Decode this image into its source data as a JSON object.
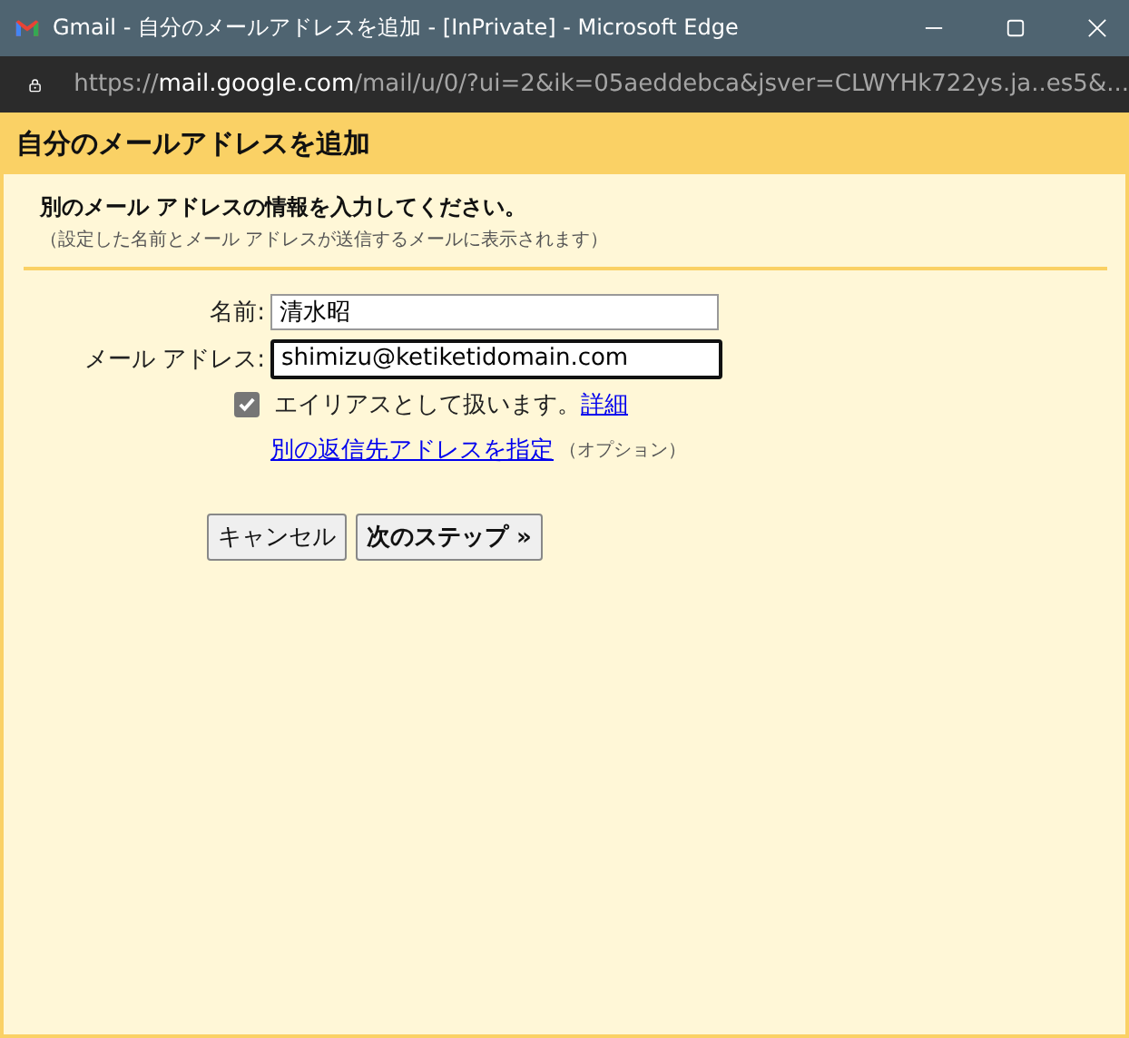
{
  "window": {
    "title": "Gmail - 自分のメールアドレスを追加 - [InPrivate] - Microsoft Edge"
  },
  "address_bar": {
    "url": "https://**mail.google.com**/mail/u/0/?ui=2&ik=05aeddebca&jsver=CLWYHk722ys.ja..es5&..."
  },
  "header": {
    "title": "自分のメールアドレスを追加"
  },
  "intro": {
    "heading": "別のメール アドレスの情報を入力してください。",
    "note": "（設定した名前とメール アドレスが送信するメールに表示されます）"
  },
  "fields": [
    {
      "label": "名前:",
      "value": "清水昭",
      "focused": false
    },
    {
      "label": "メール アドレス:",
      "value": "shimizu@ketiketidomain.com",
      "focused": true
    }
  ],
  "alias": {
    "label": "エイリアスとして扱います。",
    "checked": true,
    "link": "詳細"
  },
  "reply_to": {
    "link": "別の返信先アドレスを指定",
    "note": "（オプション）"
  },
  "buttons": [
    {
      "label": "キャンセル",
      "primary": false
    },
    {
      "label": "次のステップ »",
      "primary": true
    }
  ]
}
